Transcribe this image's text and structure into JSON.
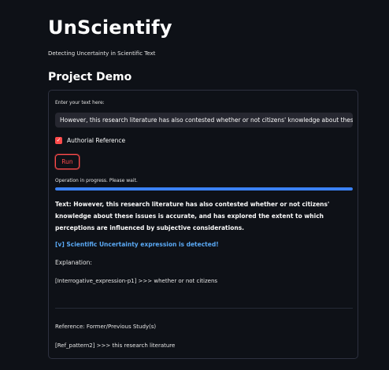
{
  "header": {
    "title": "UnScientify",
    "subtitle": "Detecting Uncertainty in Scientific Text"
  },
  "section": {
    "title": "Project Demo"
  },
  "form": {
    "input_label": "Enter your text here:",
    "input_value": "However, this research literature has also contested whether or not citizens' knowledge about these issues is accurate, and has explored the extent to which perceptions are influenced by subjective considerations.",
    "checkbox_label": "Authorial Reference",
    "checkbox_checked": true,
    "run_label": "Run"
  },
  "progress": {
    "text": "Operation in progress. Please wait.",
    "fraction": 1.0
  },
  "result": {
    "text": "Text: However, this research literature has also contested whether or not citizens' knowledge about these issues is accurate, and has explored the extent to which perceptions are influenced by subjective considerations.",
    "detected": "[v] Scientific Uncertainty expression is detected!",
    "explanation_label": "Explanation:",
    "pattern": "[Interrogative_expression-p1] >>> whether or not citizens"
  },
  "reference": {
    "label": "Reference: Former/Previous Study(s)",
    "pattern": "[Ref_pattern2] >>> this research literature"
  },
  "colors": {
    "background": "#0e1117",
    "accent": "#ff4b4b",
    "progress": "#3b82f6",
    "detected": "#5aa9f5"
  }
}
